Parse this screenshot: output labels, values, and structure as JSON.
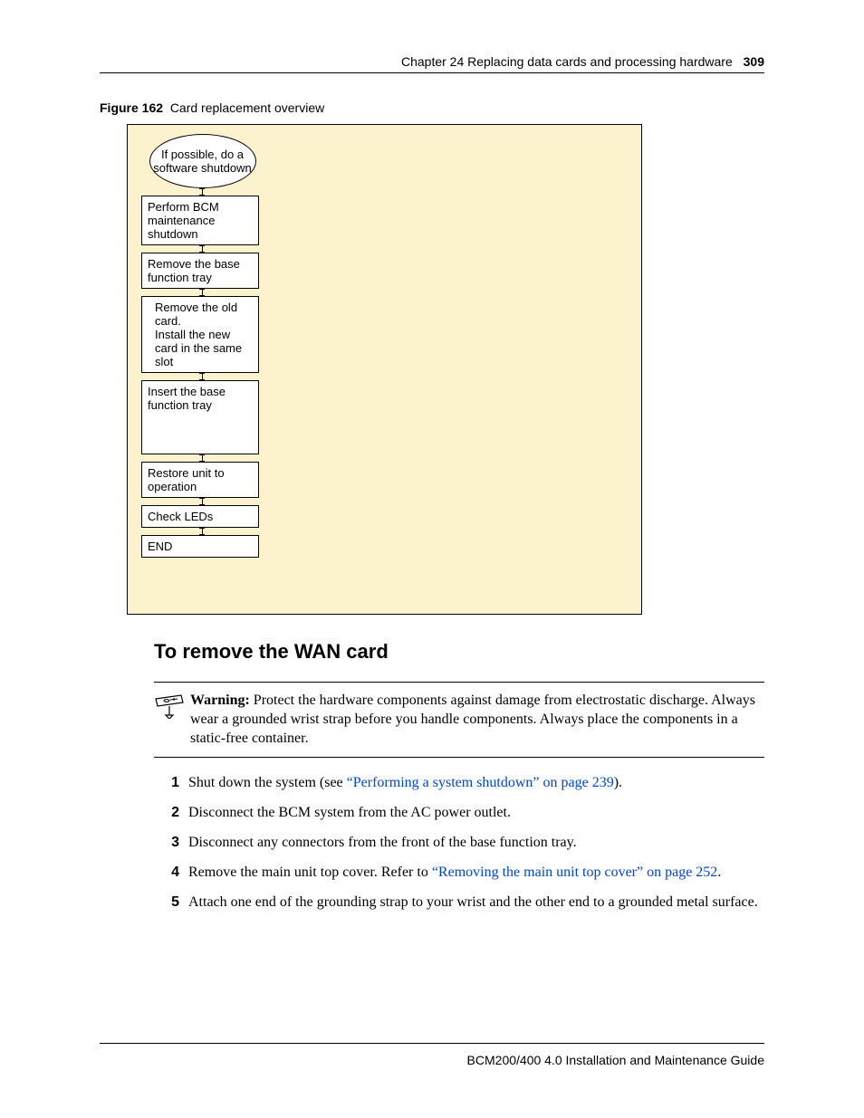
{
  "header": {
    "chapter": "Chapter 24  Replacing data cards and processing hardware",
    "page": "309"
  },
  "figure": {
    "label": "Figure 162",
    "title": "Card replacement overview",
    "chart_data": {
      "type": "flowchart",
      "nodes": [
        {
          "shape": "oval",
          "text": "If possible, do a software shutdown"
        },
        {
          "shape": "box",
          "text": "Perform BCM maintenance shutdown"
        },
        {
          "shape": "box",
          "text": "Remove the base function tray"
        },
        {
          "shape": "box",
          "text": "Remove the old card.\nInstall the new card in the same slot"
        },
        {
          "shape": "box",
          "text": "Insert the base function tray"
        },
        {
          "shape": "box",
          "text": "Restore unit to operation"
        },
        {
          "shape": "box",
          "text": "Check LEDs"
        },
        {
          "shape": "box",
          "text": "END"
        }
      ]
    }
  },
  "section": {
    "heading": "To remove the WAN card",
    "warning_label": "Warning:",
    "warning_text": " Protect the hardware components against damage from electrostatic discharge. Always wear a grounded wrist strap before you handle components. Always place the components in a static-free container.",
    "steps": [
      {
        "num": "1",
        "pre": "Shut down the system (see ",
        "link": "“Performing a system shutdown” on page 239",
        "post": ")."
      },
      {
        "num": "2",
        "pre": "Disconnect the BCM system from the AC power outlet.",
        "link": "",
        "post": ""
      },
      {
        "num": "3",
        "pre": "Disconnect any connectors from the front of the base function tray.",
        "link": "",
        "post": ""
      },
      {
        "num": "4",
        "pre": "Remove the main unit top cover. Refer to ",
        "link": "“Removing the main unit top cover” on page 252",
        "post": "."
      },
      {
        "num": "5",
        "pre": "Attach one end of the grounding strap to your wrist and the other end to a grounded metal surface.",
        "link": "",
        "post": ""
      }
    ]
  },
  "footer": "BCM200/400 4.0 Installation and Maintenance Guide"
}
